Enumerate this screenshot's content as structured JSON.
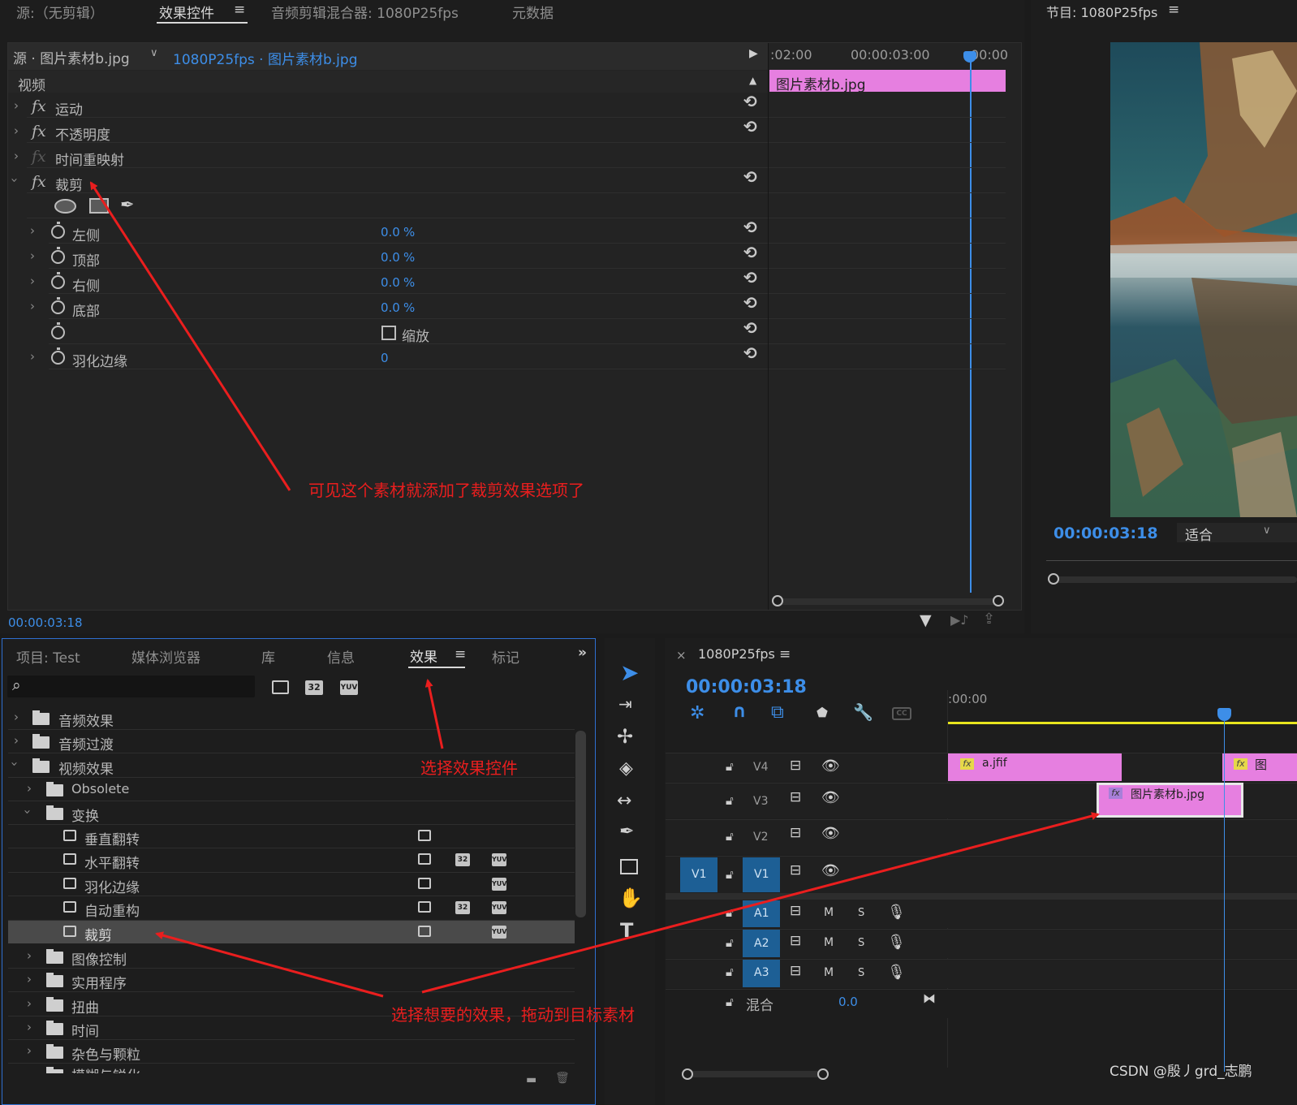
{
  "source_panel": {
    "tabs": [
      "源:（无剪辑）",
      "效果控件",
      "音频剪辑混合器: 1080P25fps",
      "元数据"
    ]
  },
  "program_panel": {
    "title": "节目: 1080P25fps",
    "timecode": "00:00:03:18",
    "fit": "适合"
  },
  "effect_controls": {
    "source_label": "源 · 图片素材b.jpg",
    "sequence_link": "1080P25fps · 图片素材b.jpg",
    "section": "视频",
    "effects": [
      "运动",
      "不透明度",
      "时间重映射",
      "裁剪"
    ],
    "params": [
      {
        "name": "左侧",
        "value": "0.0",
        "unit": "%"
      },
      {
        "name": "顶部",
        "value": "0.0",
        "unit": "%"
      },
      {
        "name": "右侧",
        "value": "0.0",
        "unit": "%"
      },
      {
        "name": "底部",
        "value": "0.0",
        "unit": "%"
      }
    ],
    "zoom_label": "缩放",
    "feather": {
      "name": "羽化边缘",
      "value": "0"
    },
    "ruler": [
      ":02:00",
      "00:00:03:00",
      "00:00"
    ],
    "clip": "图片素材b.jpg",
    "timecode": "00:00:03:18"
  },
  "project_panel": {
    "tabs": [
      "项目: Test",
      "媒体浏览器",
      "库",
      "信息",
      "效果",
      "标记"
    ],
    "badges": [
      "32",
      "YUV"
    ],
    "tree": [
      "音频效果",
      "音频过渡",
      "视频效果",
      "Obsolete",
      "变换",
      "垂直翻转",
      "水平翻转",
      "羽化边缘",
      "自动重构",
      "裁剪",
      "图像控制",
      "实用程序",
      "扭曲",
      "时间",
      "杂色与颗粒",
      "模糊与锐化"
    ]
  },
  "timeline": {
    "title": "1080P25fps",
    "timecode": "00:00:03:18",
    "ruler_start": ":00:00",
    "tracks": [
      "V4",
      "V3",
      "V2",
      "V1",
      "A1",
      "A2",
      "A3"
    ],
    "m": "M",
    "s": "S",
    "mix_label": "混合",
    "mix_value": "0.0",
    "clips": [
      "a.jfif",
      "图片素材b.jpg",
      "图"
    ]
  },
  "annotations": {
    "a1": "可见这个素材就添加了裁剪效果选项了",
    "a2": "选择效果控件",
    "a3": "选择想要的效果，拖动到目标素材"
  },
  "watermark": "CSDN @殷丿grd_志鹏",
  "colors": {
    "accent": "#3d8ee8",
    "clip": "#e67fe0",
    "annotation": "#ea1e1e"
  }
}
